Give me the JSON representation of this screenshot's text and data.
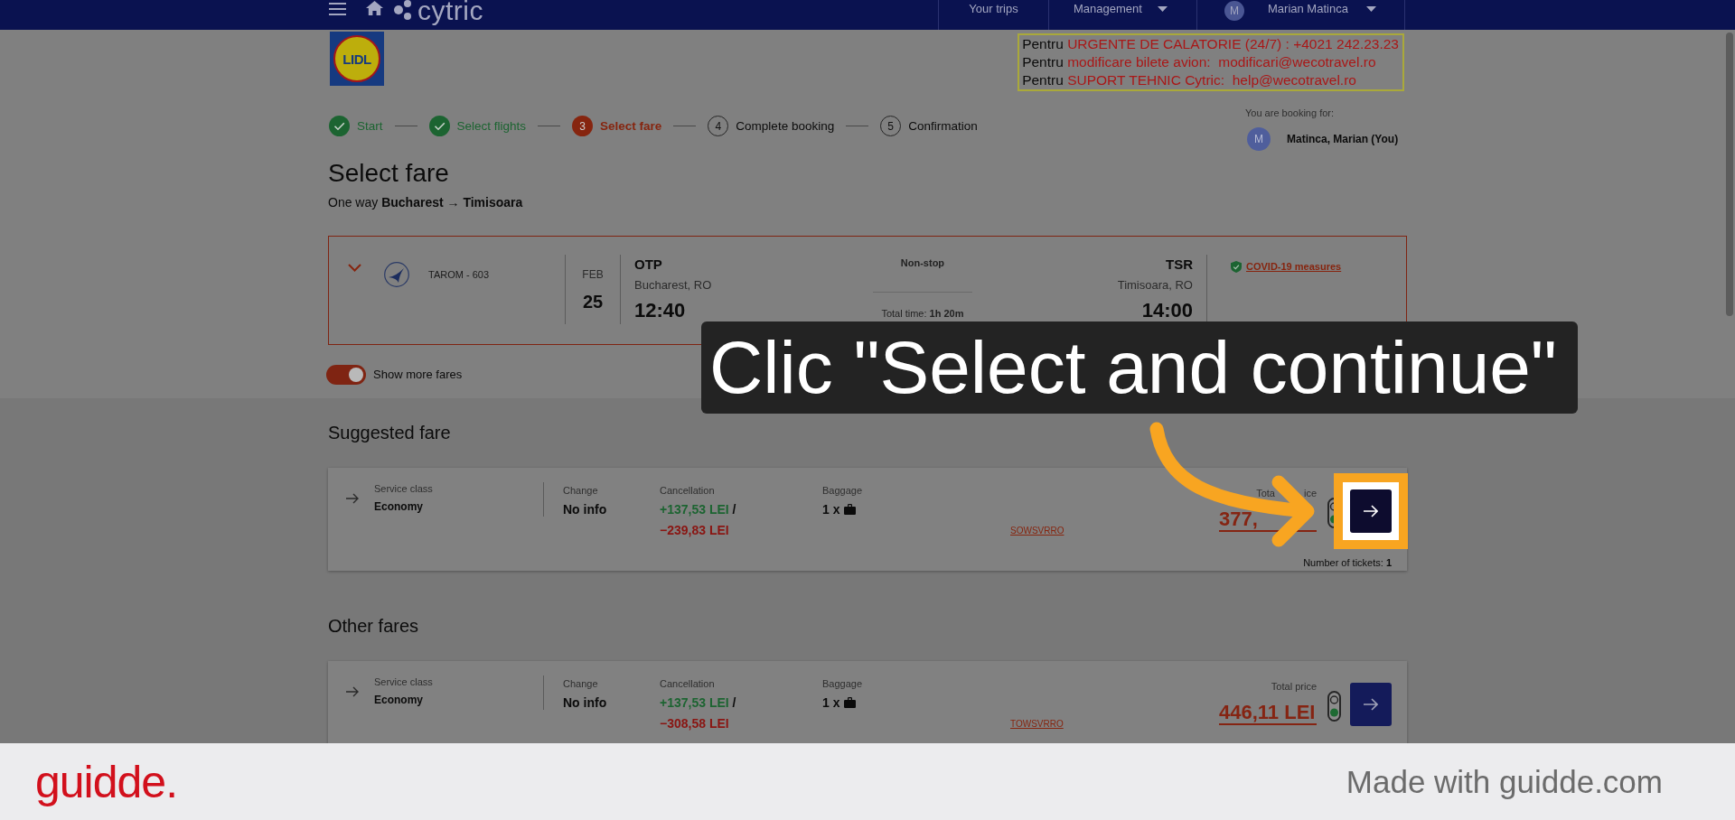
{
  "nav": {
    "brand": "cytric",
    "items": [
      {
        "label": "Your trips",
        "kind": "link"
      },
      {
        "label": "Management",
        "kind": "dropdown"
      }
    ],
    "user": {
      "initial": "M",
      "name": "Marian Matinca"
    }
  },
  "company_logo": {
    "text": "LIDL"
  },
  "contact_notice": [
    {
      "prefix": "Pentru",
      "text": "URGENTE DE CALATORIE (24/7) : +4021 242.23.23"
    },
    {
      "prefix": "Pentru",
      "text": "modificare bilete avion:  modificari@wecotravel.ro"
    },
    {
      "prefix": "Pentru",
      "text": "SUPORT TEHNIC Cytric:  help@wecotravel.ro"
    }
  ],
  "steps": [
    {
      "label": "Start",
      "completed": true,
      "selected": false
    },
    {
      "label": "Select flights",
      "completed": true,
      "selected": false
    },
    {
      "number": "3",
      "label": "Select fare",
      "completed": false,
      "selected": true
    },
    {
      "number": "4",
      "label": "Complete booking",
      "completed": false,
      "selected": false
    },
    {
      "number": "5",
      "label": "Confirmation",
      "completed": false,
      "selected": false
    }
  ],
  "booking_for": {
    "label": "You are booking for:",
    "initial": "M",
    "name": "Matinca, Marian (You)"
  },
  "page_title": "Select fare",
  "route": "One way **Bucharest** → **Timisoara**",
  "flight": {
    "airline": "TAROM - 603",
    "month": "FEB",
    "day": "25",
    "departure": {
      "code": "OTP",
      "city": "Bucharest, RO",
      "time": "12:40"
    },
    "stops": "Non-stop",
    "duration": "Total time: **1h 20m**",
    "arrival": {
      "code": "TSR",
      "city": "Timisoara, RO",
      "time": "14:00"
    },
    "covid_link": "COVID-19 measures"
  },
  "more_fares_toggle": {
    "label": "Show more fares",
    "on": true
  },
  "fare_sections": [
    {
      "title": "Suggested fare",
      "fares": [
        {
          "service_label": "Service class",
          "service_class": "Economy",
          "change_label": "Change",
          "change": "No info",
          "cancellation_label": "Cancellation",
          "refund": "+137,53 LEI",
          "refund_separator": "/",
          "penalty": "−239,83 LEI",
          "baggage_label": "Baggage",
          "baggage": "1 x",
          "fare_code": "SOWSVRRO",
          "price_label": [
            "Tota",
            "ice"
          ],
          "price": [
            "377,"
          ],
          "tickets": "Number of tickets: **1**",
          "highlighted": true
        }
      ]
    },
    {
      "title": "Other fares",
      "fares": [
        {
          "service_label": "Service class",
          "service_class": "Economy",
          "change_label": "Change",
          "change": "No info",
          "cancellation_label": "Cancellation",
          "refund": "+137,53 LEI",
          "refund_separator": "/",
          "penalty": "−308,58 LEI",
          "baggage_label": "Baggage",
          "baggage": "1 x",
          "fare_code": "TOWSVRRO",
          "price_label": [
            "Total price"
          ],
          "price": [
            "446,11 LEI"
          ],
          "highlighted": false
        }
      ]
    }
  ],
  "tutorial": {
    "caption": "Clic \"Select and continue\""
  },
  "footer": {
    "brand": "guidde.",
    "credit": "Made with guidde.com"
  }
}
